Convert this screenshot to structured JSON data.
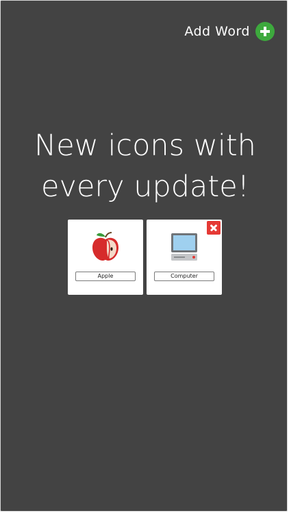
{
  "header": {
    "add_word_label": "Add Word",
    "add_icon": "plus-circle-icon",
    "accent_color": "#3da93d"
  },
  "headline": {
    "line1": "New icons with",
    "line2": "every update!"
  },
  "cards": [
    {
      "label": "Apple",
      "icon": "apple-icon",
      "deletable": false
    },
    {
      "label": "Computer",
      "icon": "computer-icon",
      "deletable": true,
      "delete_color": "#e53935"
    }
  ],
  "colors": {
    "background": "#434343",
    "card": "#ffffff"
  }
}
